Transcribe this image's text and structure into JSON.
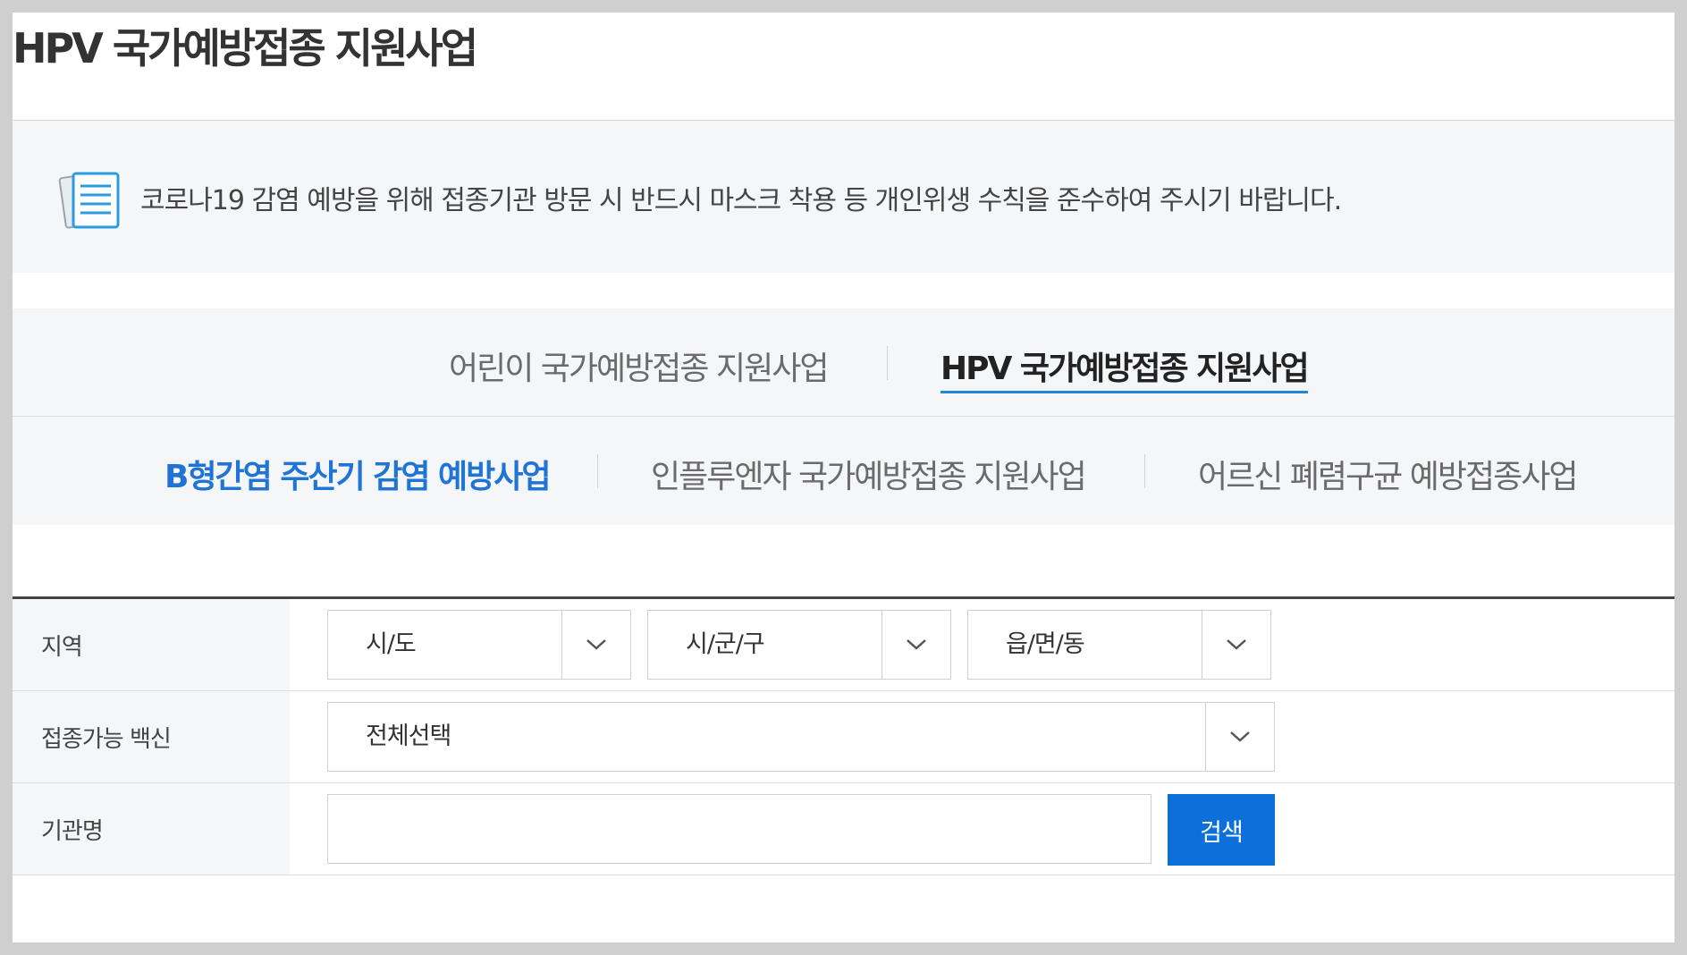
{
  "page": {
    "title": "HPV 국가예방접종 지원사업"
  },
  "notice": {
    "icon": "document-list-icon",
    "text": "코로나19 감염 예방을 위해 접종기관 방문 시 반드시 마스크 착용 등 개인위생 수칙을 준수하여 주시기 바랍니다."
  },
  "tabs": {
    "row1": [
      {
        "label": "어린이 국가예방접종 지원사업",
        "active": false
      },
      {
        "label": "HPV 국가예방접종 지원사업",
        "active": true
      }
    ],
    "row2": [
      {
        "label": "B형간염 주산기 감염 예방사업",
        "highlight": true
      },
      {
        "label": "인플루엔자 국가예방접종 지원사업",
        "highlight": false
      },
      {
        "label": "어르신 폐렴구균 예방접종사업",
        "highlight": false
      }
    ],
    "active_color": "#1f86d9",
    "highlight_color": "#1f74d6"
  },
  "form": {
    "region": {
      "label": "지역",
      "sido": "시/도",
      "sigungu": "시/군/구",
      "eupmyeondong": "읍/면/동"
    },
    "vaccine": {
      "label": "접종가능 백신",
      "value": "전체선택"
    },
    "institution": {
      "label": "기관명",
      "value": "",
      "search_label": "검색"
    },
    "dropdown_icon": "chevron-down-icon",
    "search_button_color": "#0d6fd9"
  }
}
